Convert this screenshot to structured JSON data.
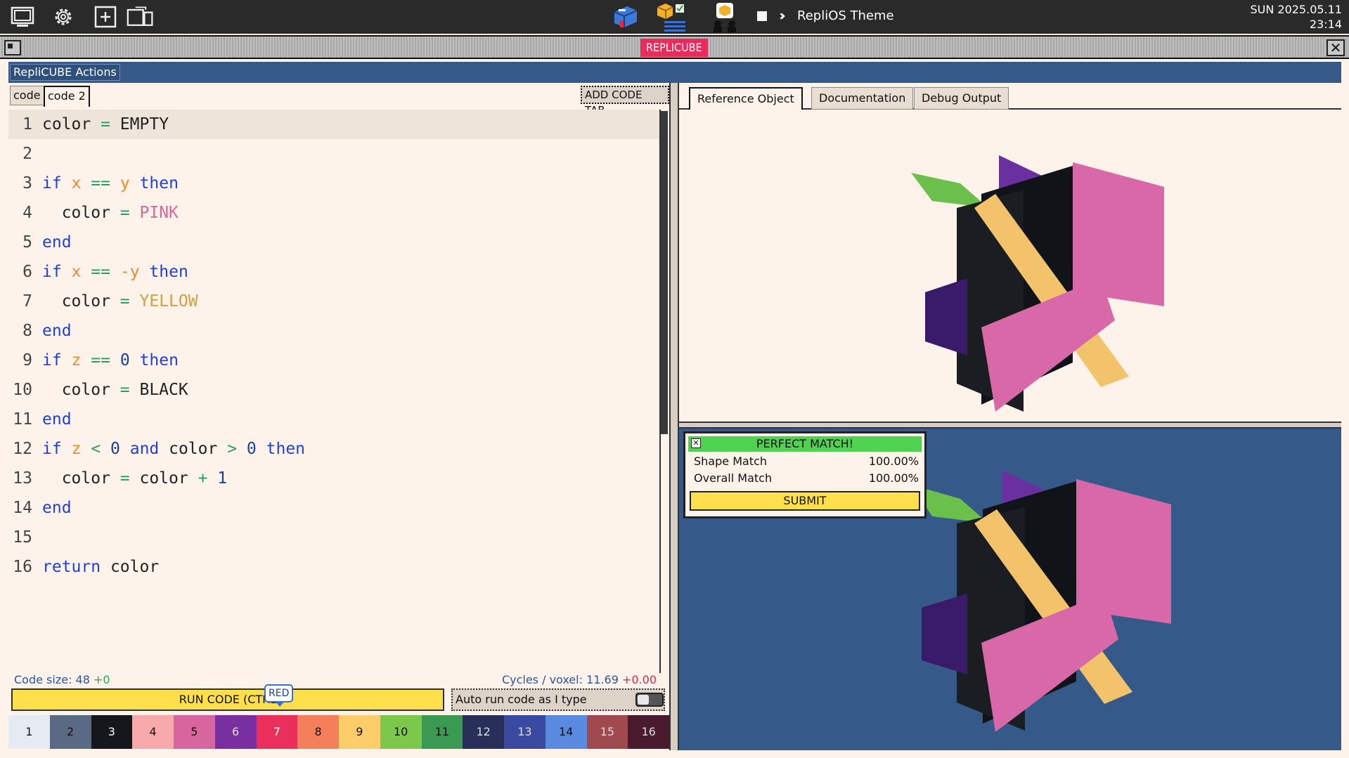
{
  "system_bar": {
    "theme_label": "RepliOS Theme",
    "clock_date": "SUN 2025.05.11",
    "clock_time": "23:14"
  },
  "window": {
    "title": "REPLICUBE"
  },
  "actions": {
    "label": "RepliCUBE Actions"
  },
  "editor": {
    "tabs": [
      "code",
      "code 2"
    ],
    "add_tab_label": "ADD CODE TAB",
    "lines": [
      {
        "n": "1"
      },
      {
        "n": "2"
      },
      {
        "n": "3"
      },
      {
        "n": "4"
      },
      {
        "n": "5"
      },
      {
        "n": "6"
      },
      {
        "n": "7"
      },
      {
        "n": "8"
      },
      {
        "n": "9"
      },
      {
        "n": "10"
      },
      {
        "n": "11"
      },
      {
        "n": "12"
      },
      {
        "n": "13"
      },
      {
        "n": "14"
      },
      {
        "n": "15"
      },
      {
        "n": "16"
      }
    ],
    "code_size_label": "Code size: 48",
    "code_size_delta": "+0",
    "cycles_label": "Cycles / voxel: 11.69",
    "cycles_delta": "+0.00",
    "run_label": "RUN CODE (CTRL",
    "tooltip": "RED",
    "autorun_label": "Auto run code as I type"
  },
  "palette": [
    {
      "label": "1",
      "color": "#e6eaf2",
      "text": "#111111"
    },
    {
      "label": "2",
      "color": "#5a6a84",
      "text": "#111111"
    },
    {
      "label": "3",
      "color": "#14181c",
      "text": "#ffffff"
    },
    {
      "label": "4",
      "color": "#f7a9ac",
      "text": "#111111"
    },
    {
      "label": "5",
      "color": "#d8669e",
      "text": "#111111"
    },
    {
      "label": "6",
      "color": "#7a2fa0",
      "text": "#dddddd"
    },
    {
      "label": "7",
      "color": "#ea2f5c",
      "text": "#ffffff"
    },
    {
      "label": "8",
      "color": "#f57f5a",
      "text": "#111111"
    },
    {
      "label": "9",
      "color": "#fdcd6a",
      "text": "#111111"
    },
    {
      "label": "10",
      "color": "#7cc84a",
      "text": "#111111"
    },
    {
      "label": "11",
      "color": "#3a9a52",
      "text": "#111111"
    },
    {
      "label": "12",
      "color": "#28305a",
      "text": "#dddddd"
    },
    {
      "label": "13",
      "color": "#3a4aa0",
      "text": "#dddddd"
    },
    {
      "label": "14",
      "color": "#5a8ae0",
      "text": "#111111"
    },
    {
      "label": "15",
      "color": "#a04a50",
      "text": "#dddddd"
    },
    {
      "label": "16",
      "color": "#4a1a2e",
      "text": "#dddddd"
    }
  ],
  "reference": {
    "tabs": [
      "Reference Object",
      "Documentation",
      "Debug Output"
    ]
  },
  "match": {
    "header": "PERFECT MATCH!",
    "shape_label": "Shape Match",
    "shape_value": "100.00%",
    "overall_label": "Overall Match",
    "overall_value": "100.00%",
    "submit_label": "SUBMIT"
  }
}
